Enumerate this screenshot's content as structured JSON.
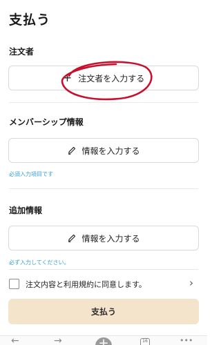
{
  "header": {
    "title": "支払う"
  },
  "orderer": {
    "label": "注文者",
    "button_label": "注文者を入力する",
    "plus_icon": "+"
  },
  "membership": {
    "label": "メンバーシップ情報",
    "button_label": "情報を入力する",
    "helper": "必須入力項目です"
  },
  "additional": {
    "label": "追加情報",
    "button_label": "情報を入力する",
    "helper": "必ず入力してください。"
  },
  "agreement": {
    "text": "注文内容と利用規約に同意します。",
    "checked": false,
    "chevron": "›"
  },
  "pay_button": {
    "label": "支払う"
  },
  "bottom_bar": {
    "back_icon": "←",
    "forward_icon": "→",
    "new_tab_icon": "+",
    "tab_count": "16",
    "menu_icon": "•••"
  },
  "colors": {
    "helper_text": "#3aa0d8",
    "pay_button_bg": "#f4e4cc",
    "annotation": "#c8102e"
  }
}
